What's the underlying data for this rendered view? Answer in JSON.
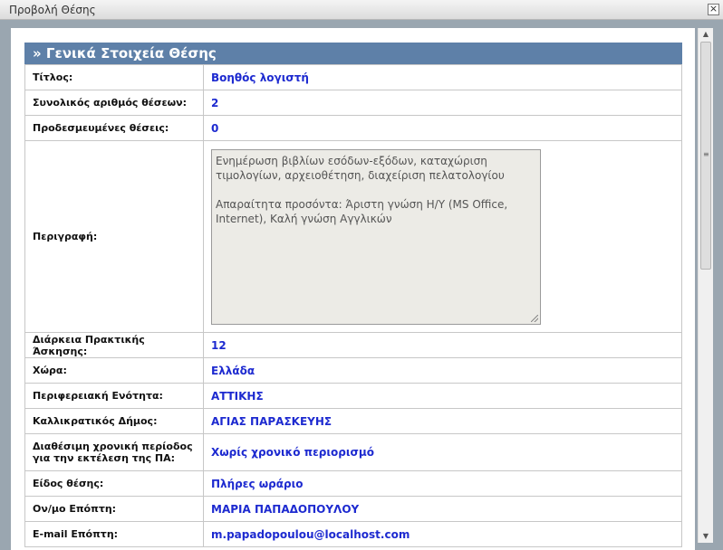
{
  "window": {
    "title": "Προβολή Θέσης",
    "close_label": "⨯"
  },
  "section": {
    "title": "» Γενικά Στοιχεία Θέσης"
  },
  "fields": {
    "title": {
      "label": "Τίτλος:",
      "value": "Βοηθός λογιστή"
    },
    "total_positions": {
      "label": "Συνολικός αριθμός θέσεων:",
      "value": "2"
    },
    "reserved_positions": {
      "label": "Προδεσμευμένες θέσεις:",
      "value": "0"
    },
    "description": {
      "label": "Περιγραφή:",
      "value": "Ενημέρωση βιβλίων εσόδων-εξόδων, καταχώριση τιμολογίων, αρχειοθέτηση, διαχείριση πελατολογίου\n\nΑπαραίτητα προσόντα: Άριστη γνώση Η/Υ (MS Office, Internet), Καλή γνώση Αγγλικών"
    },
    "duration": {
      "label": "Διάρκεια Πρακτικής Άσκησης:",
      "value": "12"
    },
    "country": {
      "label": "Χώρα:",
      "value": "Ελλάδα"
    },
    "region": {
      "label": "Περιφερειακή Ενότητα:",
      "value": "ΑΤΤΙΚΗΣ"
    },
    "municipality": {
      "label": "Καλλικρατικός Δήμος:",
      "value": "ΑΓΙΑΣ ΠΑΡΑΣΚΕΥΗΣ"
    },
    "available_period": {
      "label": "Διαθέσιμη χρονική περίοδος για την εκτέλεση της ΠΑ:",
      "value": "Χωρίς χρονικό περιορισμό"
    },
    "position_type": {
      "label": "Είδος θέσης:",
      "value": "Πλήρες ωράριο"
    },
    "supervisor_name": {
      "label": "Ον/μο Επόπτη:",
      "value": "ΜΑΡΙΑ ΠΑΠΑΔΟΠΟΥΛΟΥ"
    },
    "supervisor_email": {
      "label": "E-mail Επόπτη:",
      "value": "m.papadopoulou@localhost.com"
    }
  }
}
